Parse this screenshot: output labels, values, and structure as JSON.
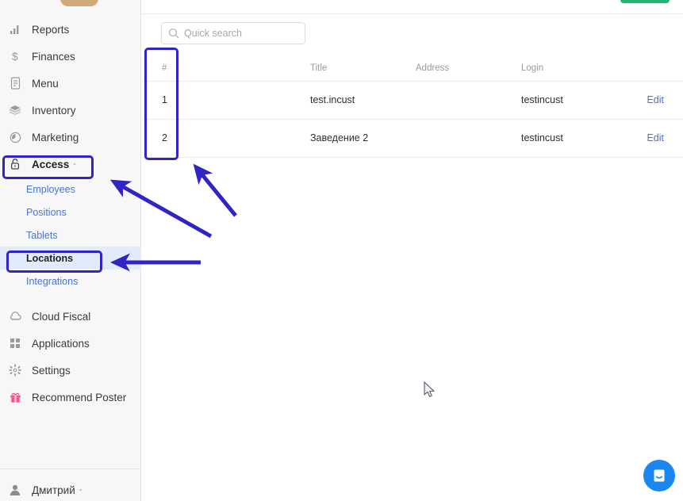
{
  "app": {
    "brand_accent": "#4a73d6",
    "annotation_color": "#3124c4",
    "green_accent": "#22b573",
    "chat_accent": "#1a86f0"
  },
  "sidebar": {
    "items": [
      {
        "label": "Reports",
        "icon": "bar-chart-icon"
      },
      {
        "label": "Finances",
        "icon": "dollar-icon"
      },
      {
        "label": "Menu",
        "icon": "document-icon"
      },
      {
        "label": "Inventory",
        "icon": "layers-icon"
      },
      {
        "label": "Marketing",
        "icon": "clock-icon"
      },
      {
        "label": "Access",
        "icon": "lock-icon",
        "caret": "-"
      },
      {
        "label": "Cloud Fiscal",
        "icon": "cloud-icon"
      },
      {
        "label": "Applications",
        "icon": "grid-icon"
      },
      {
        "label": "Settings",
        "icon": "gear-icon"
      },
      {
        "label": "Recommend Poster",
        "icon": "gift-icon"
      }
    ],
    "submenu": [
      {
        "label": "Employees"
      },
      {
        "label": "Positions"
      },
      {
        "label": "Tablets"
      },
      {
        "label": "Locations"
      },
      {
        "label": "Integrations"
      }
    ],
    "user": {
      "label": "Дмитрий",
      "caret": "-",
      "icon": "user-avatar-icon"
    }
  },
  "search": {
    "placeholder": "Quick search",
    "value": "",
    "icon": "search-icon"
  },
  "table": {
    "columns": [
      "#",
      "Title",
      "Address",
      "Login",
      ""
    ],
    "rows": [
      {
        "num": "1",
        "title": "test.incust",
        "address": "",
        "login": "testincust",
        "action": "Edit"
      },
      {
        "num": "2",
        "title": "Заведение 2",
        "address": "",
        "login": "testincust",
        "action": "Edit"
      }
    ]
  },
  "chat": {
    "icon": "intercom-chat-icon"
  }
}
